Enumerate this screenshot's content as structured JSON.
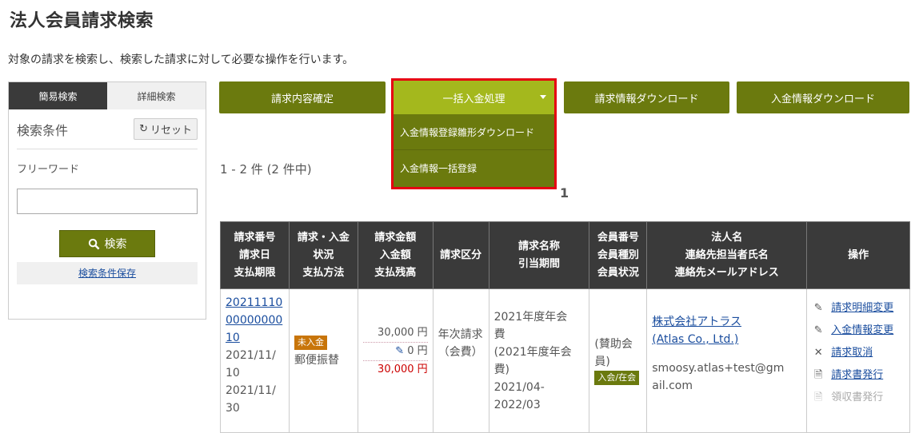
{
  "page": {
    "title": "法人会員請求検索",
    "description": "対象の請求を検索し、検索した請求に対して必要な操作を行います。"
  },
  "sidebar": {
    "tabs": [
      "簡易検索",
      "詳細検索"
    ],
    "conditions_title": "検索条件",
    "reset_label": "リセット",
    "freeword_label": "フリーワード",
    "freeword_value": "",
    "search_button": "検索",
    "save_link": "検索条件保存"
  },
  "toolbar": {
    "confirm_label": "請求内容確定",
    "bulk_payment_label": "一括入金処理",
    "dropdown_items": [
      "入金情報登録雛形ダウンロード",
      "入金情報一括登録"
    ],
    "download_invoice_label": "請求情報ダウンロード",
    "download_payment_label": "入金情報ダウンロード"
  },
  "results": {
    "count_text": "1 - 2 件 (2 件中)",
    "page_number": "1",
    "headers": [
      [
        "請求番号",
        "請求日",
        "支払期限"
      ],
      [
        "請求・入金",
        "状況",
        "支払方法"
      ],
      [
        "請求金額",
        "入金額",
        "支払残高"
      ],
      [
        "請求区分"
      ],
      [
        "請求名称",
        "引当期間"
      ],
      [
        "会員番号",
        "会員種別",
        "会員状況"
      ],
      [
        "法人名",
        "連絡先担当者氏名",
        "連絡先メールアドレス"
      ],
      [
        "操作"
      ]
    ],
    "rows": [
      {
        "invoice_no_lines": [
          "20211110",
          "00000000",
          "10"
        ],
        "invoice_date_lines": [
          "2021/11/",
          "10"
        ],
        "due_date_lines": [
          "2021/11/",
          "30"
        ],
        "status_badge": "未入金",
        "payment_method": "郵便振替",
        "billed": "30,000 円",
        "paid": "0 円",
        "balance": "30,000 円",
        "category": "年次請求（会費）",
        "name_lines": [
          "2021年度年会",
          "費",
          "(2021年度年会",
          "費)",
          "2021/04-",
          "2022/03"
        ],
        "member_type": "(賛助会員)",
        "member_status": "入会/在会",
        "company_name": "株式会社アトラス",
        "company_name_en": "(Atlas Co., Ltd.)",
        "email_lines": [
          "smoosy.atlas+test@gm",
          "ail.com"
        ],
        "operations": [
          {
            "label": "請求明細変更",
            "icon": "pencil-icon",
            "enabled": true
          },
          {
            "label": "入金情報変更",
            "icon": "pencil-icon",
            "enabled": true
          },
          {
            "label": "請求取消",
            "icon": "close-icon",
            "enabled": true
          },
          {
            "label": "請求書発行",
            "icon": "document-icon",
            "enabled": true
          },
          {
            "label": "領収書発行",
            "icon": "document-icon",
            "enabled": false
          }
        ]
      }
    ]
  },
  "colors": {
    "accent": "#6b7a0e",
    "accent_light": "#a4b81d",
    "highlight_border": "#e60012",
    "header_dark": "#3a3a3a",
    "link": "#1a4d9e"
  }
}
